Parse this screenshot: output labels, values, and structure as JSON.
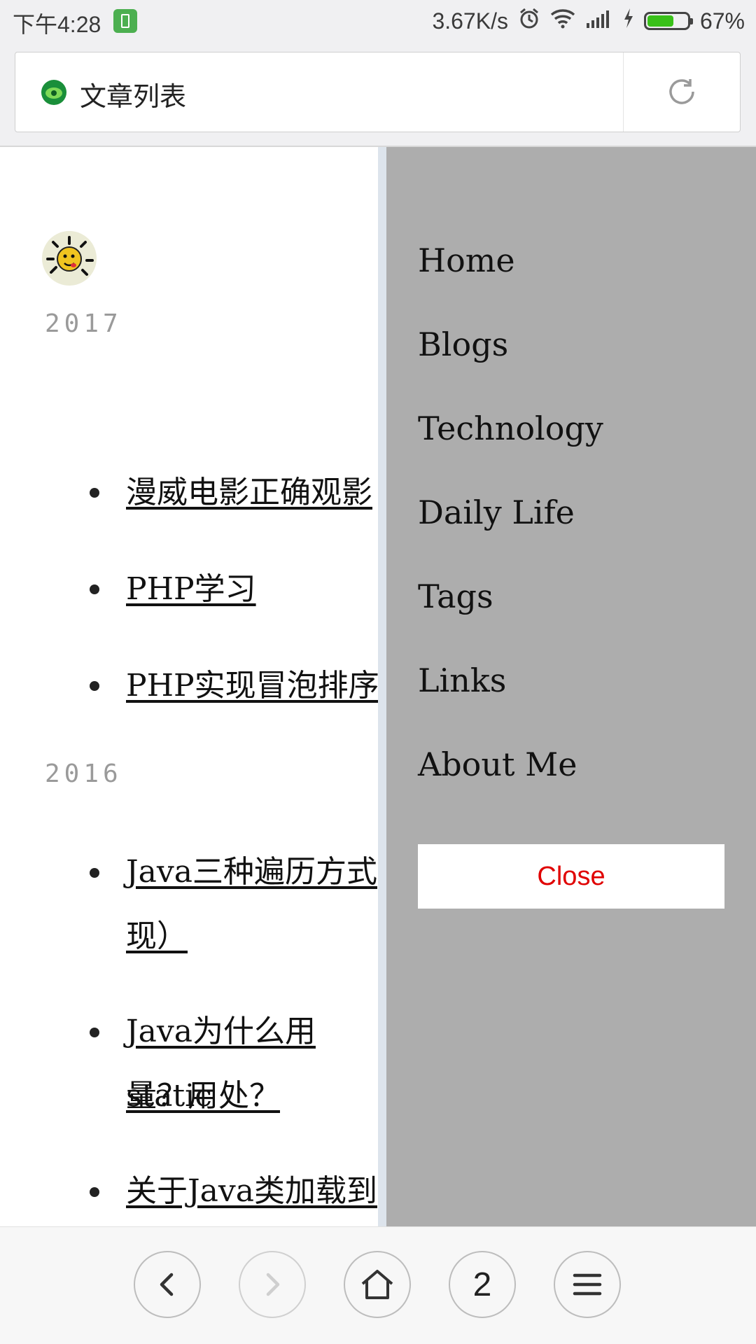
{
  "status_bar": {
    "time": "下午4:28",
    "network_speed": "3.67K/s",
    "battery_percent": "67%",
    "battery_level": 0.67,
    "icons": [
      "battery-notification-icon",
      "alarm-icon",
      "wifi-icon",
      "signal-icon",
      "charging-icon",
      "battery-icon"
    ]
  },
  "browser": {
    "page_title": "文章列表",
    "icons": [
      "site-favicon-icon",
      "reload-icon"
    ]
  },
  "content": {
    "years": [
      {
        "year": "2017",
        "posts": [
          "漫威电影正确观影",
          "PHP学习",
          "PHP实现冒泡排序"
        ]
      },
      {
        "year": "2016",
        "posts": [
          "Java三种遍历方式",
          "现）",
          "Java为什么用static",
          "量？用处？",
          "关于Java类加载到"
        ]
      }
    ]
  },
  "menu": {
    "items": [
      "Home",
      "Blogs",
      "Technology",
      "Daily Life",
      "Tags",
      "Links",
      "About Me"
    ],
    "close_label": "Close"
  },
  "toolbar": {
    "tab_count": "2",
    "icons": [
      "back-icon",
      "forward-icon",
      "home-icon",
      "tabs-button",
      "menu-icon"
    ]
  },
  "colors": {
    "menu_bg": "#adadad",
    "close_text": "#e00000",
    "battery_fill": "#39c019"
  }
}
